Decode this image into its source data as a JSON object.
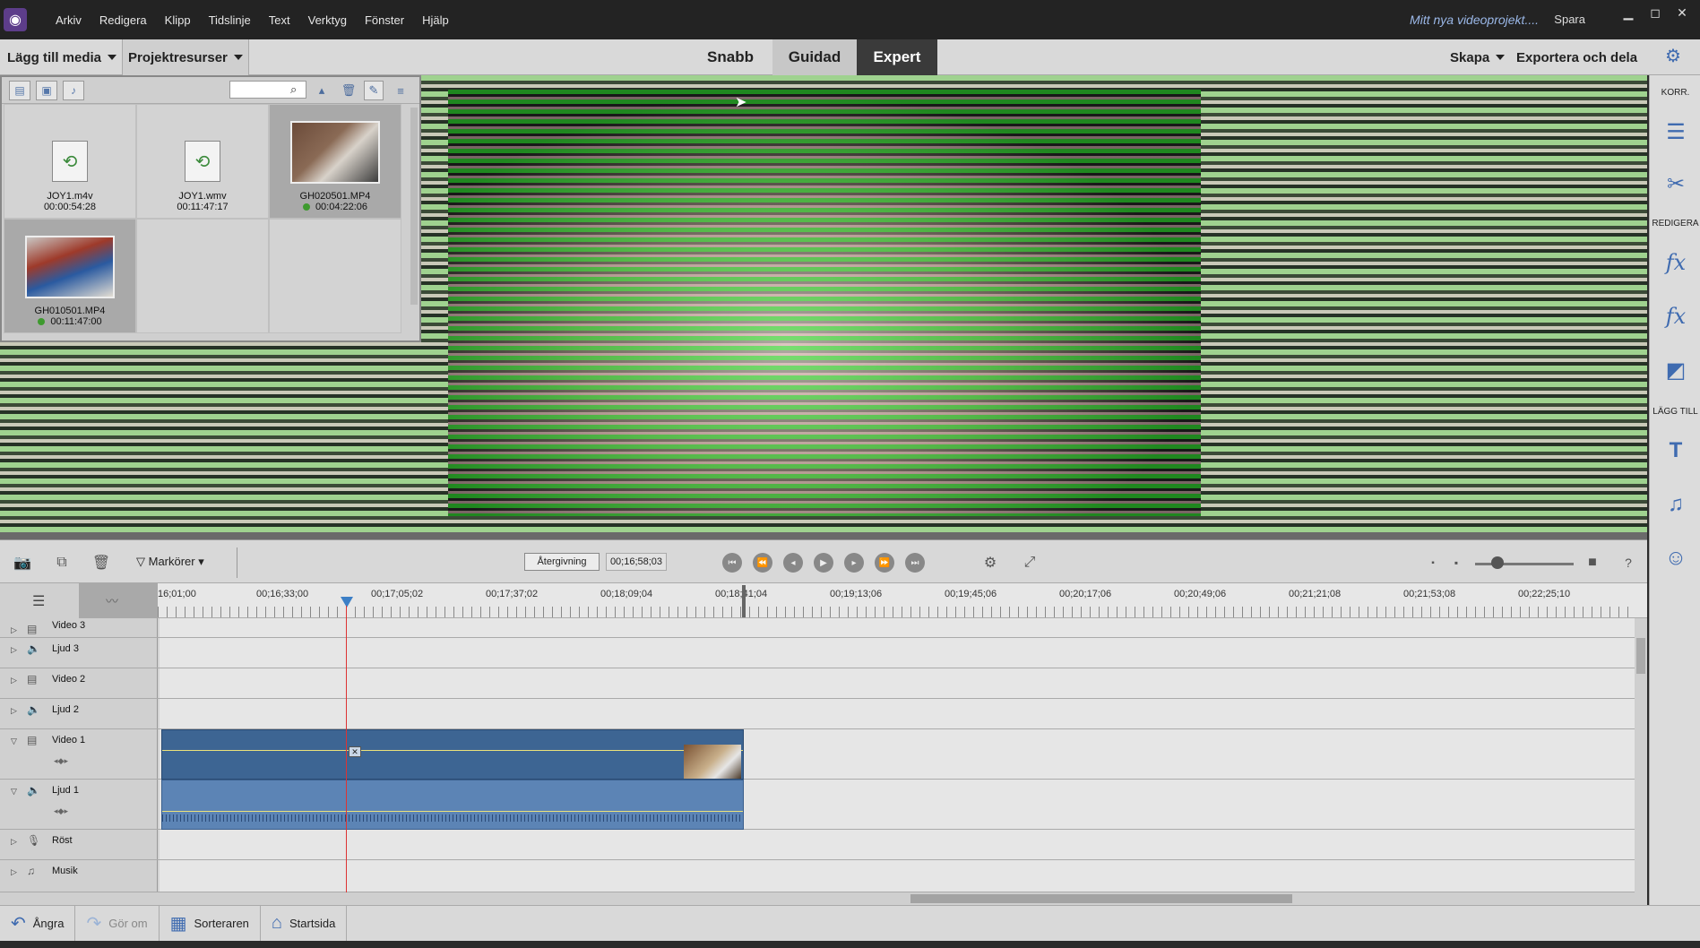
{
  "menubar": {
    "items": [
      "Arkiv",
      "Redigera",
      "Klipp",
      "Tidslinje",
      "Text",
      "Verktyg",
      "Fönster",
      "Hjälp"
    ],
    "project_title": "Mitt nya videoprojekt....",
    "save_label": "Spara"
  },
  "toolbar": {
    "add_media": "Lägg till media",
    "project_assets": "Projektresurser",
    "modes": [
      "Snabb",
      "Guidad",
      "Expert"
    ],
    "create": "Skapa",
    "export": "Exportera och dela"
  },
  "project_assets": {
    "items": [
      {
        "name": "JOY1.m4v",
        "duration": "00:00:54:28",
        "type": "file",
        "used": false
      },
      {
        "name": "JOY1.wmv",
        "duration": "00:11:47:17",
        "type": "file",
        "used": false
      },
      {
        "name": "GH020501.MP4",
        "duration": "00:04:22:06",
        "type": "video",
        "used": true
      },
      {
        "name": "GH010501.MP4",
        "duration": "00:11:47:00",
        "type": "video",
        "used": true
      }
    ]
  },
  "right_panel": {
    "sections": [
      "KORR.",
      "REDIGERA",
      "LÄGG TILL"
    ]
  },
  "timeline_controls": {
    "markers": "Markörer",
    "render": "Återgivning",
    "timecode": "00;16;58;03"
  },
  "ruler": {
    "labels": [
      "16;01;00",
      "00;16;33;00",
      "00;17;05;02",
      "00;17;37;02",
      "00;18;09;04",
      "00;18;41;04",
      "00;19;13;06",
      "00;19;45;06",
      "00;20;17;06",
      "00;20;49;06",
      "00;21;21;08",
      "00;21;53;08",
      "00;22;25;10"
    ]
  },
  "tracks": [
    {
      "name": "Video 3",
      "kind": "video"
    },
    {
      "name": "Ljud 3",
      "kind": "audio"
    },
    {
      "name": "Video 2",
      "kind": "video"
    },
    {
      "name": "Ljud 2",
      "kind": "audio"
    },
    {
      "name": "Video 1",
      "kind": "video"
    },
    {
      "name": "Ljud 1",
      "kind": "audio"
    },
    {
      "name": "Röst",
      "kind": "voice"
    },
    {
      "name": "Musik",
      "kind": "music"
    }
  ],
  "bottombar": {
    "undo": "Ångra",
    "redo": "Gör om",
    "organizer": "Sorteraren",
    "home": "Startsida"
  },
  "colors": {
    "expert_tab": "#3a3a3a",
    "clip_video": "#3d6593",
    "clip_audio": "#5c84b5",
    "playhead": "#dd3333",
    "accent_icons": "#3f6bb0"
  }
}
